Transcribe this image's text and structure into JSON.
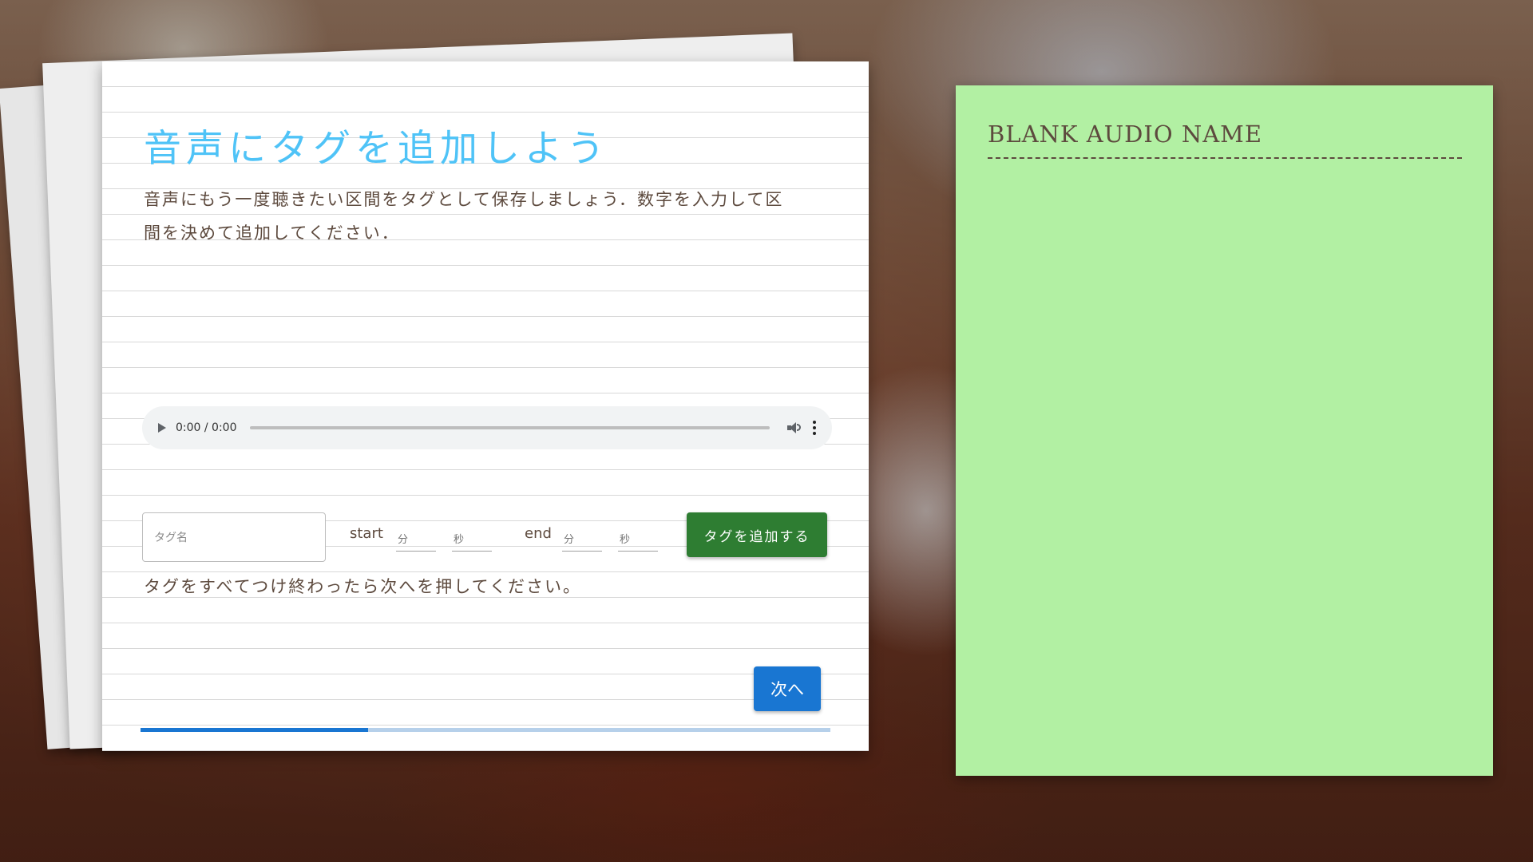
{
  "main_card": {
    "title": "音声にタグを追加しよう",
    "description": "音声にもう一度聴きたい区間をタグとして保存しましょう．数字を入力して区間を決めて追加してください．",
    "audio_player": {
      "time_display": "0:00 / 0:00",
      "icons": [
        "play-icon",
        "volume-icon",
        "more-options-icon"
      ]
    },
    "tag_form": {
      "tag_name_placeholder": "タグ名",
      "start_label": "start",
      "end_label": "end",
      "minute_placeholder": "分",
      "second_placeholder": "秒",
      "add_button_label": "タグを追加する"
    },
    "instruction": "タグをすべてつけ終わったら次へを押してください。",
    "next_button_label": "次へ",
    "progress": 0.33
  },
  "side_panel": {
    "title": "BLANK AUDIO NAME"
  },
  "colors": {
    "title": "#4fc3f7",
    "text": "#5d4a3e",
    "add_button": "#2e7d32",
    "next_button": "#1976d2",
    "side_panel": "#b2f0a3"
  }
}
